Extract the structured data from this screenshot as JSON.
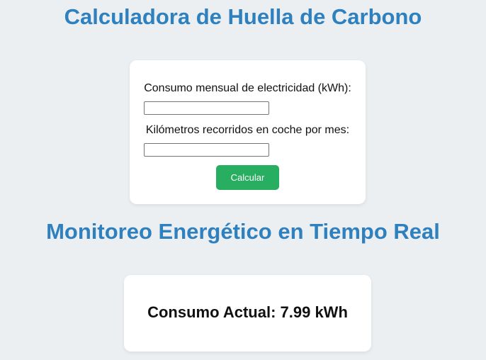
{
  "carbon_calculator": {
    "title": "Calculadora de Huella de Carbono",
    "electricity_label": "Consumo mensual de electricidad (kWh):",
    "electricity_value": "",
    "km_label": "Kilómetros recorridos en coche por mes:",
    "km_value": "",
    "calculate_button": "Calcular"
  },
  "energy_monitor": {
    "title": "Monitoreo Energético en Tiempo Real",
    "consumption_text": "Consumo Actual: 7.99 kWh"
  },
  "colors": {
    "background": "#eceff1",
    "title": "#2e80bf",
    "button": "#27ae60",
    "card": "#ffffff"
  }
}
